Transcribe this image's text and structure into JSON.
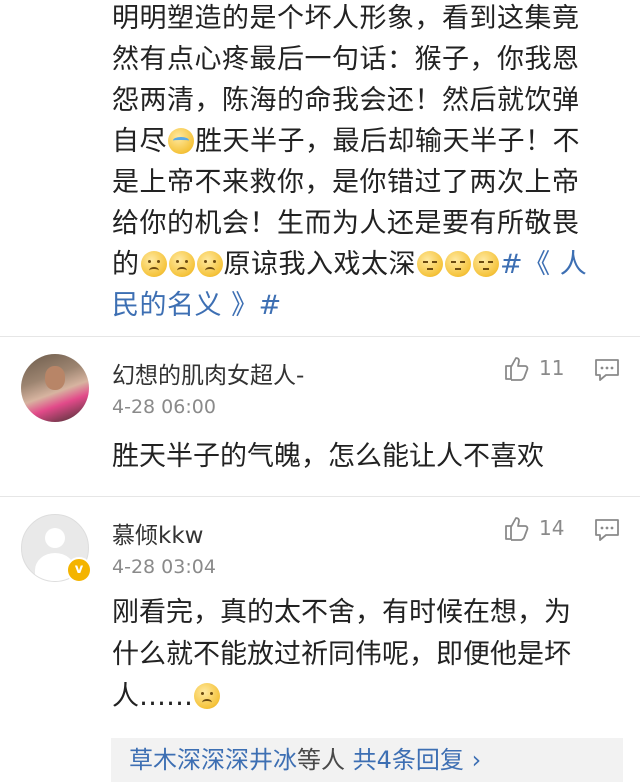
{
  "top_comment": {
    "line1": "明明塑造的是个坏人形象，看到这集竟",
    "line2": "然有点心疼最后一句话：猴子，你我恩",
    "line3": "怨两清，陈海的命我会还！然后就饮弹",
    "line4_a": "自尽",
    "line4_b": "胜天半子，最后却输天半子！不",
    "line5": "是上帝不来救你，是你错过了两次上帝",
    "line6": "给你的机会！生而为人还是要有所敬畏",
    "line7_a": "的",
    "line7_b": "原谅我入戏太深",
    "line7_topic_start": "#《 人",
    "line8_topic_end": "民的名义 》#",
    "emojis": [
      "crying-face",
      "sad-face",
      "sad-face",
      "sad-face",
      "sleepy-face",
      "sleepy-face",
      "sleepy-face"
    ]
  },
  "comments": [
    {
      "username": "幻想的肌肉女超人-",
      "time": "4-28 06:00",
      "likes": "11",
      "text": "胜天半子的气魄，怎么能让人不喜欢",
      "avatar": "photo"
    },
    {
      "username": "慕倾kkw",
      "time": "4-28 03:04",
      "likes": "14",
      "text_line1": "刚看完，真的太不舍，有时候在想，为",
      "text_line2": "什么就不能放过祈同伟呢，即便他是坏",
      "text_line3": "人……",
      "avatar": "default",
      "verified_badge": "v",
      "emoji": "sad-face"
    }
  ],
  "replies_bar": {
    "users": "草木深深深井冰",
    "middle": "等人",
    "count_link": "共4条回复",
    "arrow": "›"
  },
  "colors": {
    "link_blue": "#3d6fb3",
    "muted_gray": "#8a8a8a",
    "badge_gold": "#f4b400"
  }
}
